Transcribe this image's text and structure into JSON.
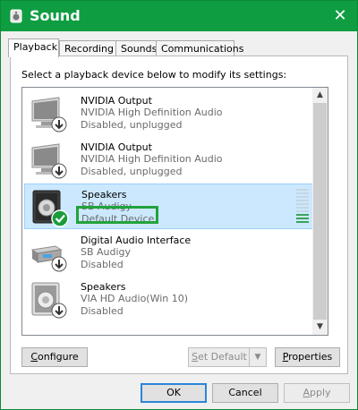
{
  "window": {
    "title": "Sound"
  },
  "tabs": [
    {
      "label": "Playback",
      "active": true
    },
    {
      "label": "Recording",
      "active": false
    },
    {
      "label": "Sounds",
      "active": false
    },
    {
      "label": "Communications",
      "active": false
    }
  ],
  "instruction": "Select a playback device below to modify its settings:",
  "devices": [
    {
      "name": "NVIDIA Output",
      "driver": "NVIDIA High Definition Audio",
      "status": "Disabled, unplugged",
      "icon": "monitor-icon"
    },
    {
      "name": "NVIDIA Output",
      "driver": "NVIDIA High Definition Audio",
      "status": "Disabled, unplugged",
      "icon": "monitor-icon"
    },
    {
      "name": "Speakers",
      "driver": "SB Audigy",
      "status": "Default Device",
      "icon": "speaker-icon",
      "selected": true,
      "default": true
    },
    {
      "name": "Digital Audio Interface",
      "driver": "SB Audigy",
      "status": "Disabled",
      "icon": "digital-audio-icon"
    },
    {
      "name": "Speakers",
      "driver": "VIA HD Audio(Win 10)",
      "status": "Disabled",
      "icon": "speaker-icon"
    }
  ],
  "buttons": {
    "configure": {
      "mnemonic": "C",
      "rest": "onfigure"
    },
    "set_default": {
      "mnemonic": "S",
      "rest": "et Default"
    },
    "properties": {
      "mnemonic": "P",
      "rest": "roperties"
    },
    "ok": "OK",
    "cancel": "Cancel",
    "apply": {
      "mnemonic": "A",
      "rest": "pply"
    }
  },
  "colors": {
    "titlebar": "#0f9d42",
    "selection": "#cce8ff",
    "default_check": "#1b9c3c",
    "highlight_box": "#22a33b"
  },
  "level_meter": {
    "level": 0.25
  }
}
